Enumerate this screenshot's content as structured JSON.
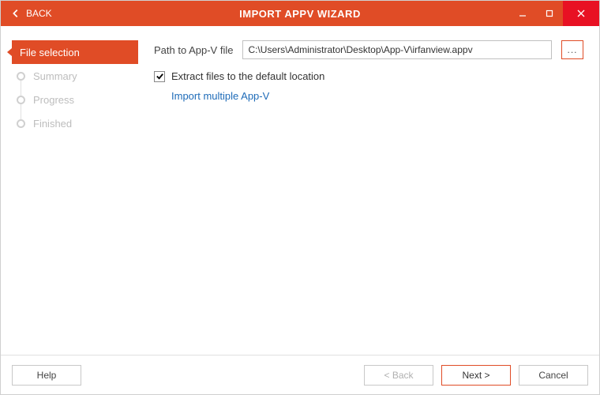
{
  "titlebar": {
    "back_label": "BACK",
    "title": "IMPORT APPV WIZARD"
  },
  "sidebar": {
    "steps": [
      {
        "label": "File selection",
        "active": true
      },
      {
        "label": "Summary",
        "active": false
      },
      {
        "label": "Progress",
        "active": false
      },
      {
        "label": "Finished",
        "active": false
      }
    ]
  },
  "main": {
    "path_label": "Path to App-V file",
    "path_value": "C:\\Users\\Administrator\\Desktop\\App-V\\irfanview.appv",
    "browse_label": "...",
    "extract_checked": true,
    "extract_label": "Extract files to the default location",
    "import_multiple_link": "Import multiple App-V"
  },
  "footer": {
    "help_label": "Help",
    "back_label": "< Back",
    "next_label": "Next >",
    "cancel_label": "Cancel"
  },
  "colors": {
    "accent": "#e04c26",
    "close": "#e81123",
    "link": "#1e6bb8"
  }
}
